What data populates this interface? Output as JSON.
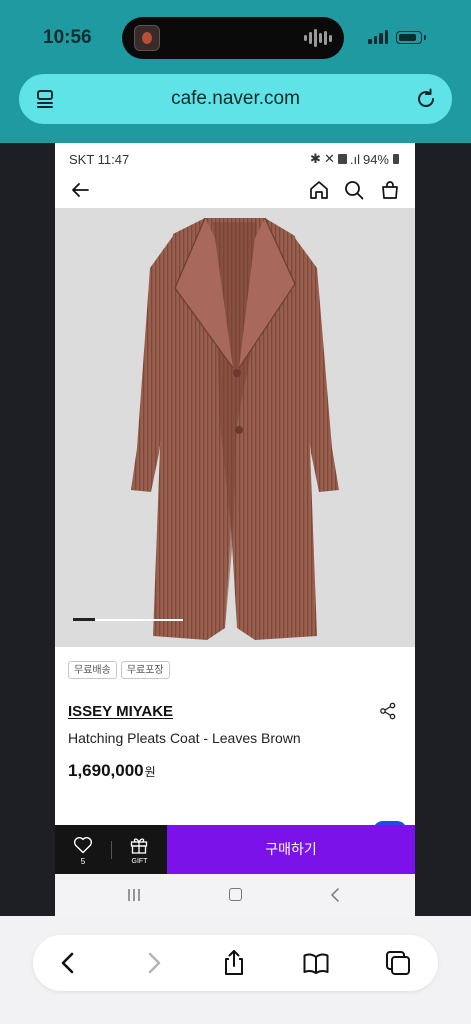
{
  "ios": {
    "time": "10:56",
    "url": "cafe.naver.com"
  },
  "android_status": {
    "carrier_time": "SKT 11:47",
    "battery": "94%"
  },
  "product": {
    "badges": [
      "무료배송",
      "무료포장"
    ],
    "brand": "ISSEY MIYAKE",
    "name": "Hatching Pleats Coat - Leaves Brown",
    "price": "1,690,000",
    "currency": "원",
    "image_index": 1
  },
  "buybar": {
    "wish_count": "5",
    "gift_label": "GIFT",
    "buy_label": "구매하기"
  },
  "colors": {
    "ios_header": "#1f9aa0",
    "url_bar": "#5fe3e6",
    "buy_button": "#7b12ea",
    "coat": "#9a5f4e"
  }
}
